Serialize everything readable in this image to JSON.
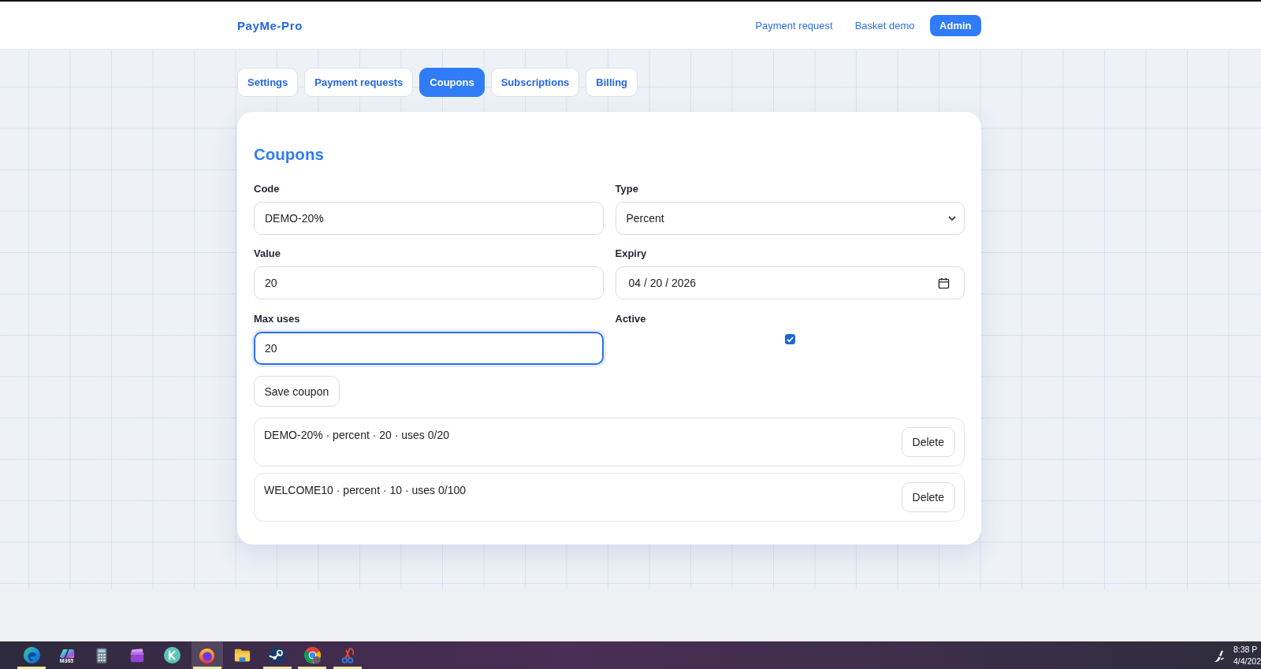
{
  "header": {
    "brand": "PayMe-Pro",
    "nav": [
      {
        "label": "Payment request",
        "selected": false
      },
      {
        "label": "Basket demo",
        "selected": false
      },
      {
        "label": "Admin",
        "selected": true
      }
    ]
  },
  "tabs": [
    {
      "label": "Settings",
      "selected": false
    },
    {
      "label": "Payment requests",
      "selected": false
    },
    {
      "label": "Coupons",
      "selected": true
    },
    {
      "label": "Subscriptions",
      "selected": false
    },
    {
      "label": "Billing",
      "selected": false
    }
  ],
  "panel": {
    "title": "Coupons",
    "fields": [
      {
        "kind": "text",
        "label": "Code",
        "value": "DEMO-20%",
        "focused": false
      },
      {
        "kind": "select",
        "label": "Type",
        "value": "Percent",
        "focused": false
      },
      {
        "kind": "text",
        "label": "Value",
        "value": "20",
        "focused": false
      },
      {
        "kind": "date",
        "label": "Expiry",
        "value": "04 / 20 / 2026",
        "focused": false
      },
      {
        "kind": "text",
        "label": "Max uses",
        "value": "20",
        "focused": true
      },
      {
        "kind": "checkbox",
        "label": "Active",
        "checked": true,
        "focused": false
      }
    ],
    "save_button": "Save coupon",
    "coupons": [
      {
        "summary": "DEMO-20% · percent · 20 · uses 0/20",
        "action": "Delete"
      },
      {
        "summary": "WELCOME10 · percent · 10 · uses 0/100",
        "action": "Delete"
      }
    ]
  },
  "taskbar": {
    "apps": [
      {
        "kind": "swirl",
        "selected": false,
        "running": true
      },
      {
        "kind": "ribbon",
        "badge": "M365",
        "selected": false,
        "running": false
      },
      {
        "kind": "calculator",
        "selected": false,
        "running": false
      },
      {
        "kind": "cards",
        "selected": false,
        "running": false
      },
      {
        "kind": "chevron-circle",
        "selected": false,
        "running": false
      },
      {
        "kind": "fox",
        "selected": true,
        "running": true
      },
      {
        "kind": "folder",
        "selected": false,
        "running": false
      },
      {
        "kind": "lever-disc",
        "selected": false,
        "running": true
      },
      {
        "kind": "ring",
        "selected": false,
        "running": true
      },
      {
        "kind": "scissors",
        "selected": false,
        "running": true
      }
    ],
    "clock": {
      "time": "8:38 P",
      "date": "4/4/202"
    }
  }
}
